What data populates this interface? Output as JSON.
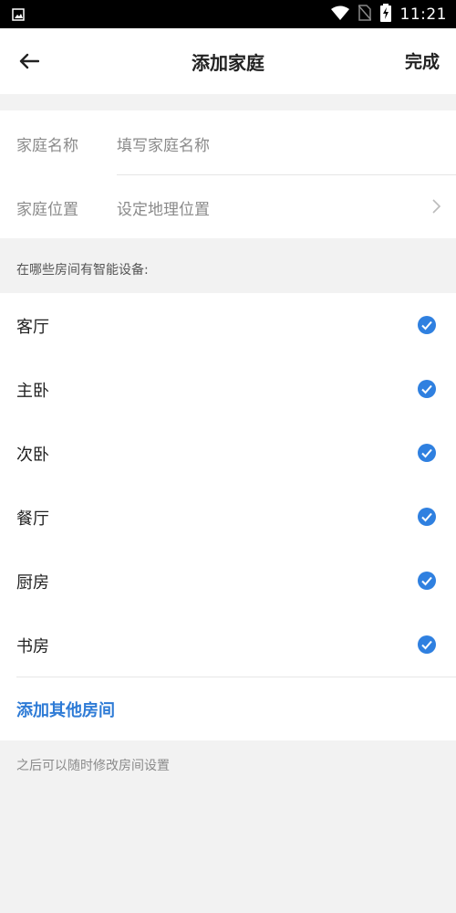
{
  "status_bar": {
    "time": "11:21",
    "icons": [
      "image-icon",
      "wifi-icon",
      "no-sim-icon",
      "battery-charging-icon"
    ]
  },
  "app_bar": {
    "title": "添加家庭",
    "done_label": "完成",
    "back_icon": "back-arrow-icon"
  },
  "form": {
    "name": {
      "label": "家庭名称",
      "placeholder": "填写家庭名称"
    },
    "location": {
      "label": "家庭位置",
      "placeholder": "设定地理位置",
      "icon": "chevron-right-icon"
    }
  },
  "rooms_section": {
    "hint": "在哪些房间有智能设备:",
    "rooms": [
      {
        "label": "客厅",
        "checked": true
      },
      {
        "label": "主卧",
        "checked": true
      },
      {
        "label": "次卧",
        "checked": true
      },
      {
        "label": "餐厅",
        "checked": true
      },
      {
        "label": "厨房",
        "checked": true
      },
      {
        "label": "书房",
        "checked": true
      }
    ],
    "add_room_label": "添加其他房间"
  },
  "footer": {
    "hint": "之后可以随时修改房间设置"
  },
  "colors": {
    "accent": "#2e7bd6",
    "check": "#2f80e0",
    "background": "#f2f2f2"
  }
}
